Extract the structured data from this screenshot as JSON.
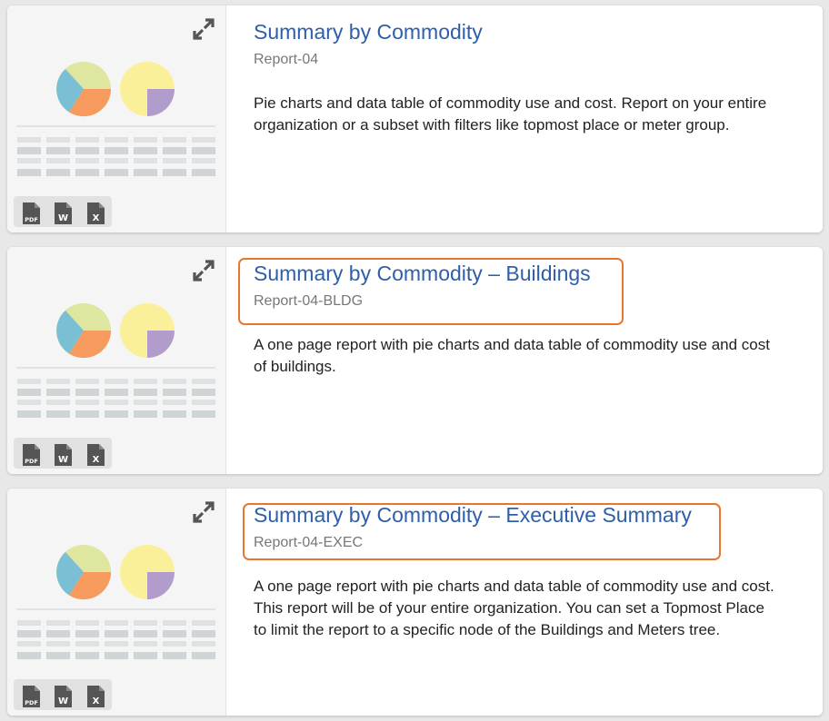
{
  "reports": [
    {
      "title": "Summary by Commodity",
      "code": "Report-04",
      "description": "Pie charts and data table of commodity use and cost. Report on your entire organization or a subset with filters like topmost place or meter group.",
      "highlighted": false
    },
    {
      "title": "Summary by Commodity – Buildings",
      "code": "Report-04-BLDG",
      "description": "A one page report with pie charts and data table of commodity use and cost of buildings.",
      "highlighted": true
    },
    {
      "title": "Summary by Commodity – Executive Summary",
      "code": "Report-04-EXEC",
      "description": "A one page report with pie charts and data table of commodity use and cost. This report will be of your entire organization. You can set a Topmost Place to limit the report to a specific node of the Buildings and Meters tree.",
      "highlighted": true
    }
  ],
  "format_icons": {
    "pdf_label": "PDF",
    "word_label": "W",
    "excel_label": "X"
  },
  "icons": [
    "expand-icon",
    "pie-chart-icon",
    "pdf-file-icon",
    "word-file-icon",
    "excel-file-icon"
  ],
  "colors": {
    "title_link": "#2e5fa8",
    "highlight_border": "#e8762d",
    "pie_green": "#dfe6a0",
    "pie_blue": "#7bbfd4",
    "pie_orange": "#f79a5e",
    "pie_yellow": "#fbf09a",
    "pie_purple": "#b29ccc"
  }
}
